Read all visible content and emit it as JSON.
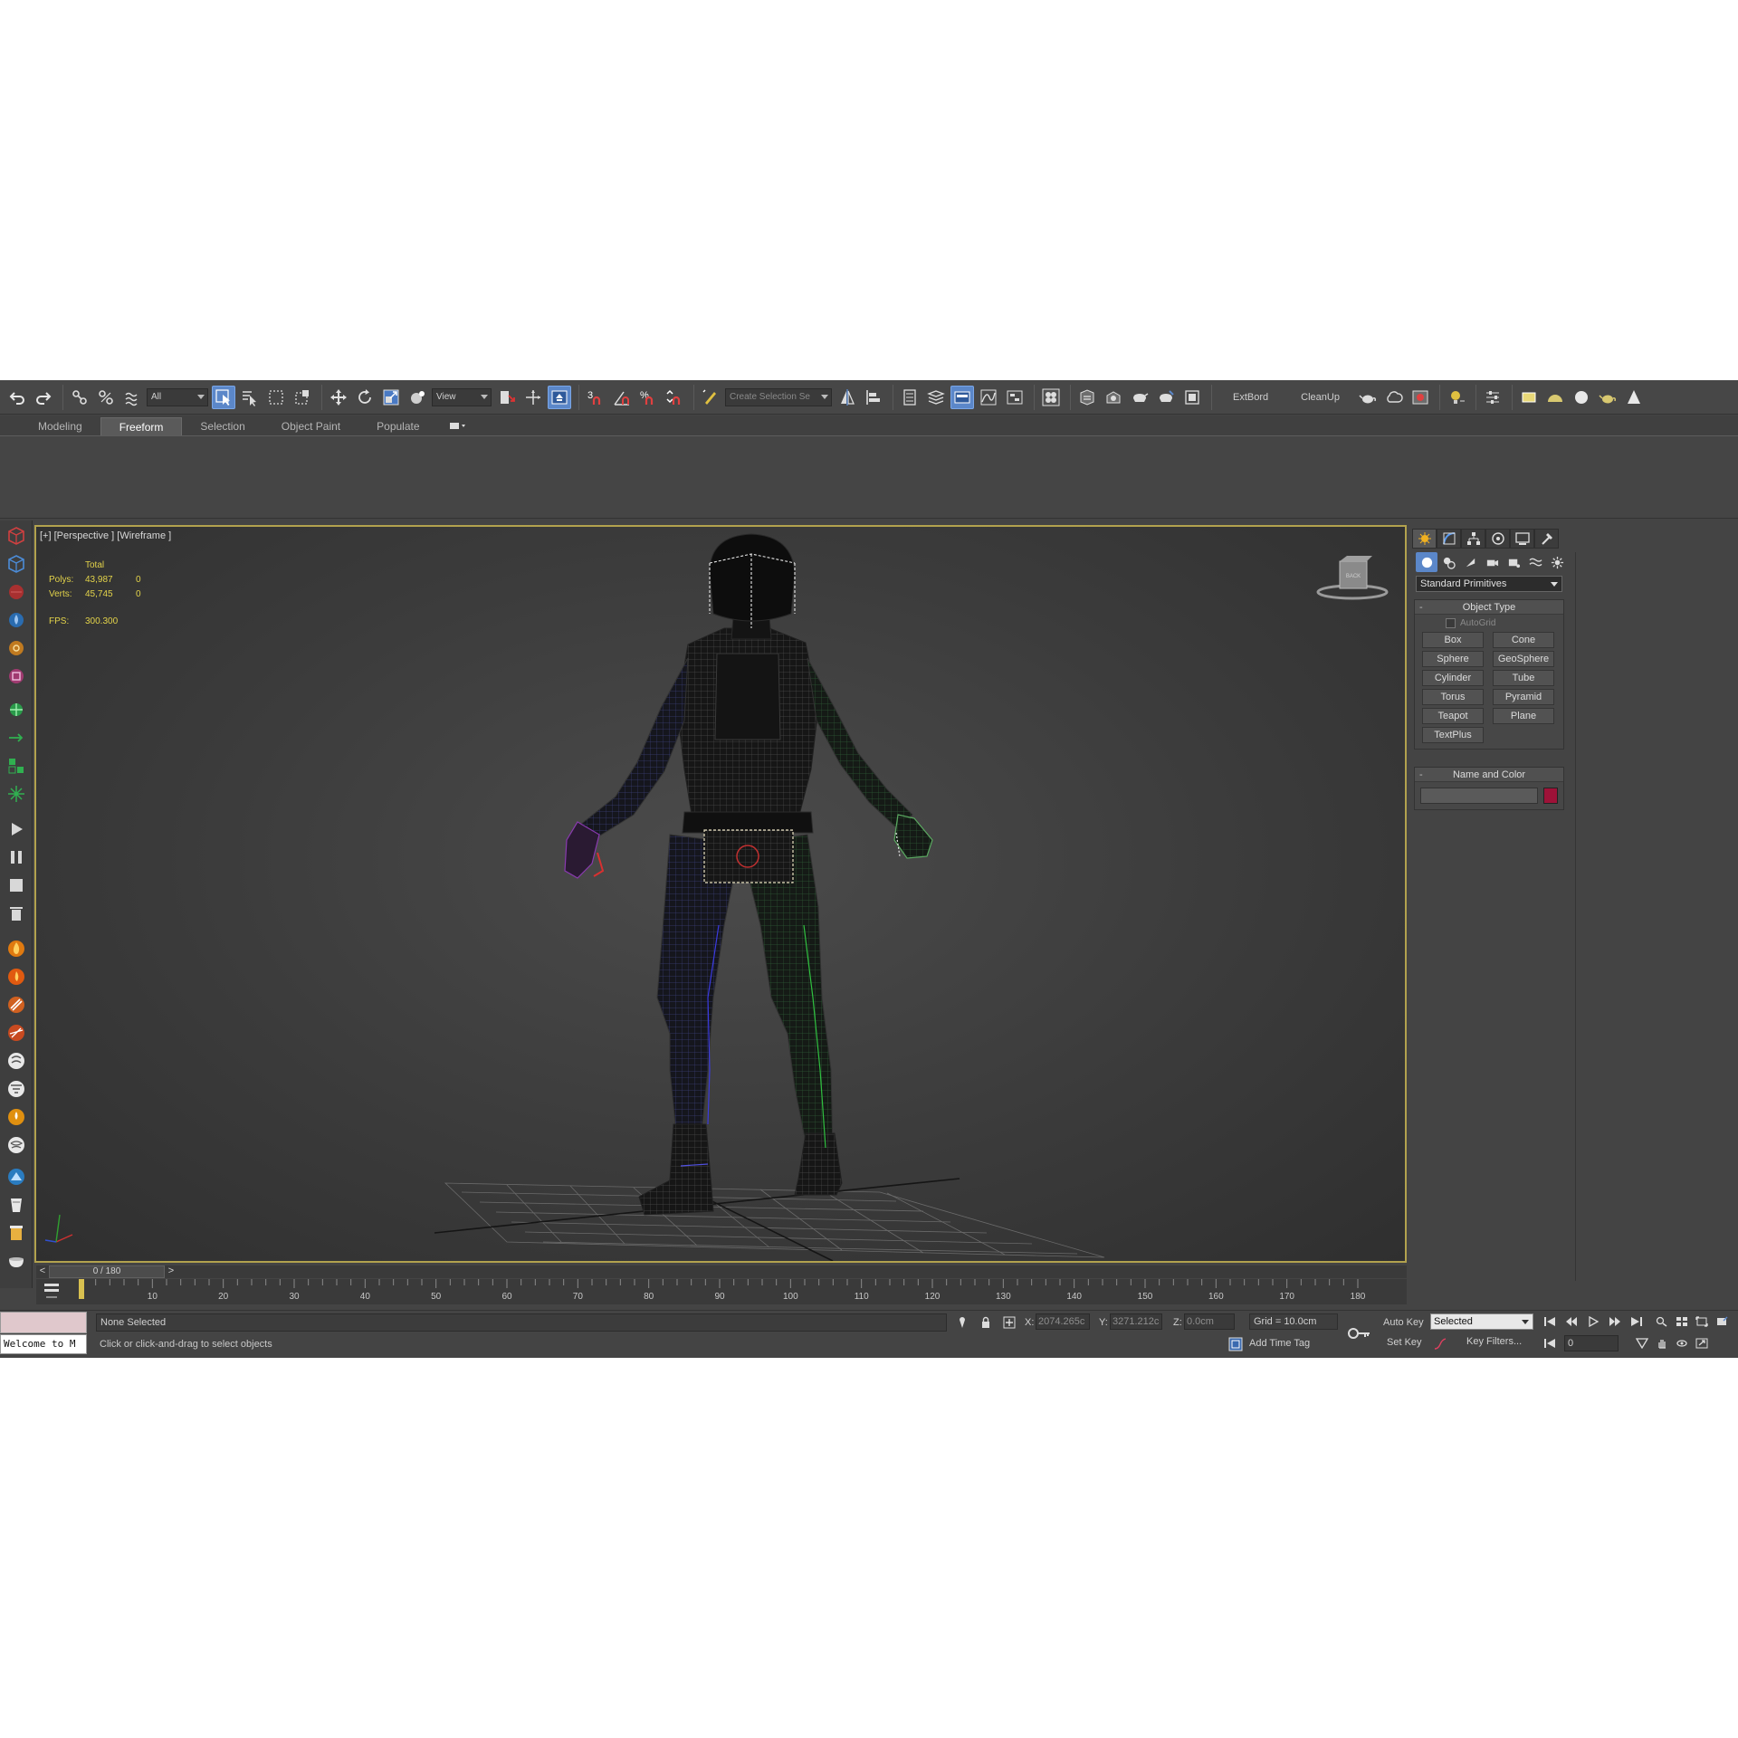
{
  "toolbar": {
    "filter_dropdown": "All",
    "refcoord_dropdown": "View",
    "selection_set_placeholder": "Create Selection Se",
    "snap_label": "3",
    "custom_1": "ExtBord",
    "custom_2": "CleanUp"
  },
  "ribbon": {
    "tabs": [
      {
        "label": "Modeling",
        "active": false
      },
      {
        "label": "Freeform",
        "active": true
      },
      {
        "label": "Selection",
        "active": false
      },
      {
        "label": "Object Paint",
        "active": false
      },
      {
        "label": "Populate",
        "active": false
      }
    ]
  },
  "viewport": {
    "label": "[+] [Perspective ] [Wireframe ]",
    "stats": {
      "header": "Total",
      "polys_label": "Polys:",
      "polys_value": "43,987",
      "polys_sel": "0",
      "verts_label": "Verts:",
      "verts_value": "45,745",
      "verts_sel": "0",
      "fps_label": "FPS:",
      "fps_value": "300.300"
    },
    "viewcube_label": "BACK"
  },
  "command_panel": {
    "category_dropdown": "Standard Primitives",
    "object_type_title": "Object Type",
    "autogrid_label": "AutoGrid",
    "primitives": [
      "Box",
      "Cone",
      "Sphere",
      "GeoSphere",
      "Cylinder",
      "Tube",
      "Torus",
      "Pyramid",
      "Teapot",
      "Plane",
      "TextPlus"
    ],
    "name_color_title": "Name and Color",
    "object_color": "#9e1238"
  },
  "timeline": {
    "slider_label": "0 / 180",
    "prev": "<",
    "next": ">",
    "ticks": [
      "0",
      "10",
      "20",
      "30",
      "40",
      "50",
      "60",
      "70",
      "80",
      "90",
      "100",
      "110",
      "120",
      "130",
      "140",
      "150",
      "160",
      "170",
      "180"
    ]
  },
  "status": {
    "maxscript_text": "Welcome to M",
    "selection": "None Selected",
    "prompt": "Click or click-and-drag to select objects",
    "x_label": "X:",
    "x_value": "2074.265c",
    "y_label": "Y:",
    "y_value": "3271.212c",
    "z_label": "Z:",
    "z_value": "0.0cm",
    "grid": "Grid = 10.0cm",
    "add_time_tag": "Add Time Tag",
    "auto_key": "Auto Key",
    "set_key": "Set Key",
    "key_mode_dropdown": "Selected",
    "key_filters": "Key Filters...",
    "current_frame": "0"
  },
  "colors": {
    "accent_blue": "#5b87c9",
    "viewport_border": "#b2a24e",
    "stats_yellow": "#e3d34a"
  }
}
